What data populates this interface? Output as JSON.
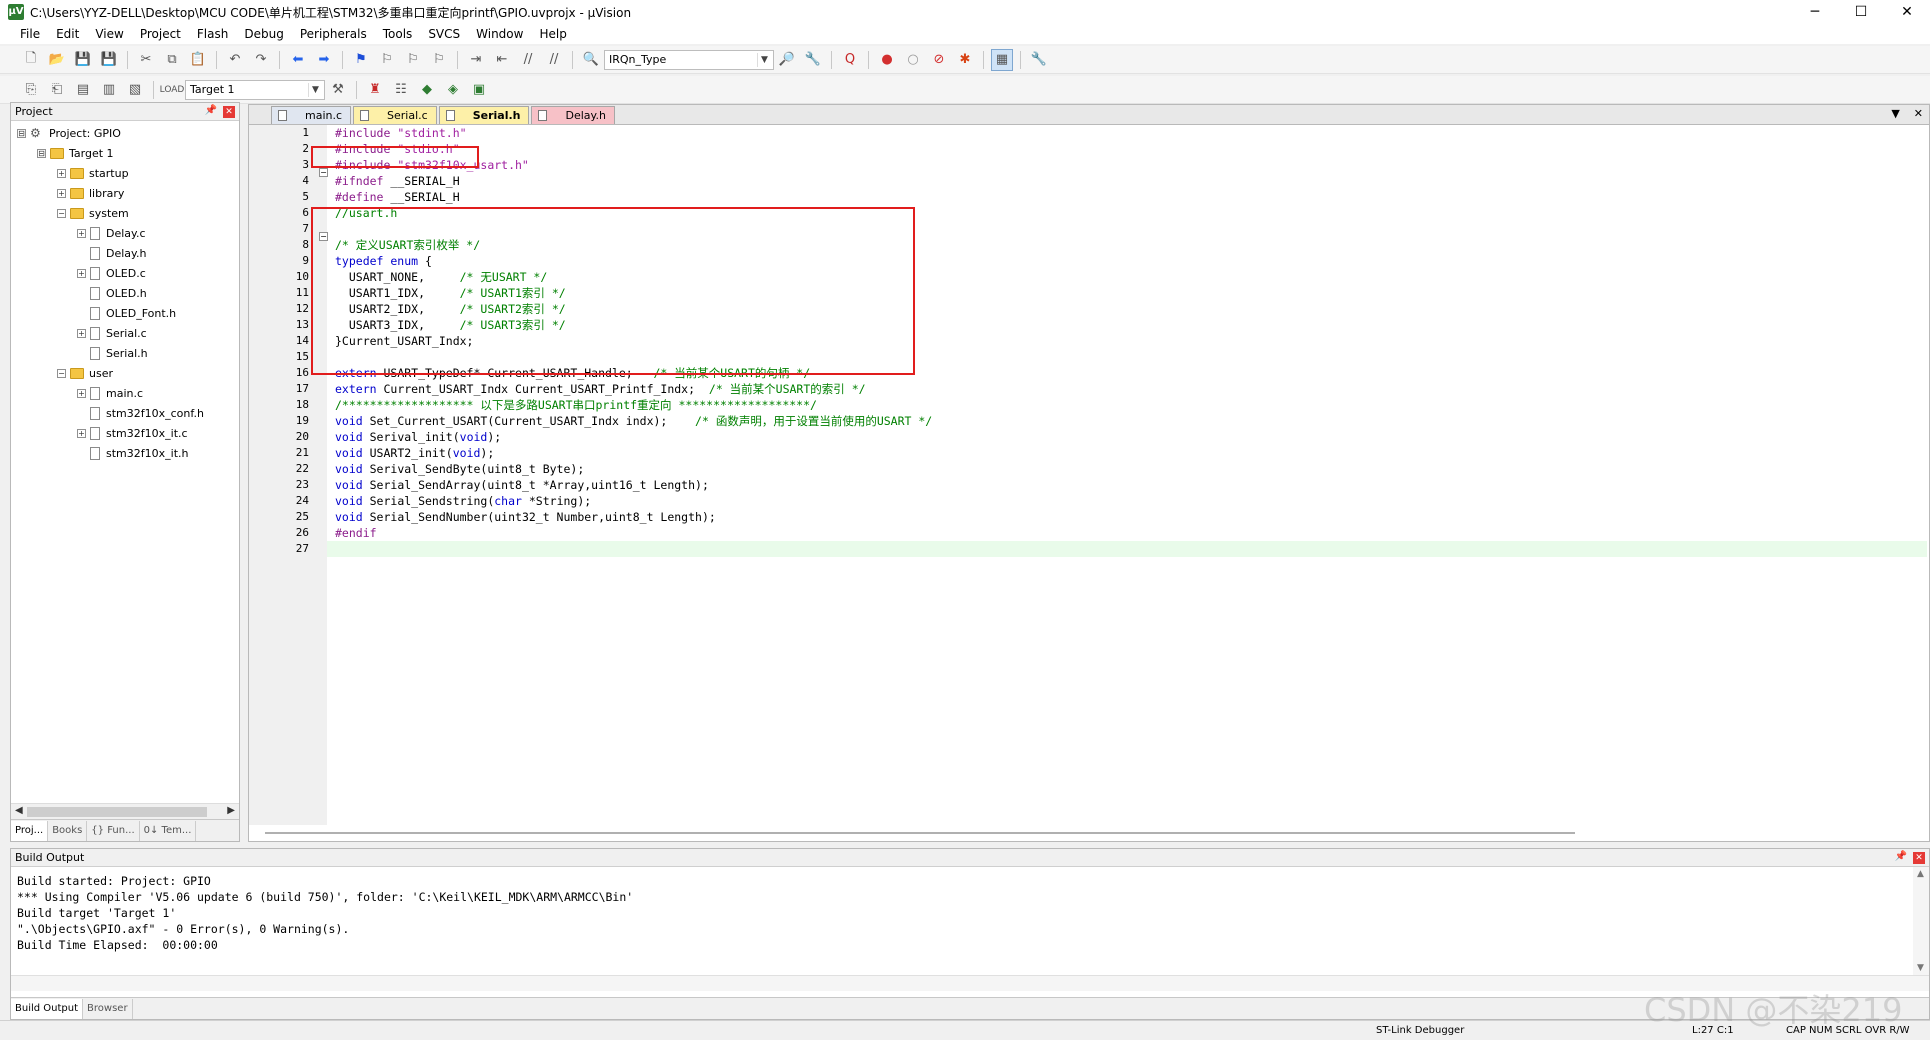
{
  "window": {
    "title": "C:\\Users\\YYZ-DELL\\Desktop\\MCU CODE\\单片机工程\\STM32\\多重串口重定向printf\\GPIO.uvprojx - µVision",
    "minimize": "─",
    "maximize": "☐",
    "close": "✕"
  },
  "menu": [
    "File",
    "Edit",
    "View",
    "Project",
    "Flash",
    "Debug",
    "Peripherals",
    "Tools",
    "SVCS",
    "Window",
    "Help"
  ],
  "toolbar": {
    "find_combo": "IRQn_Type",
    "target_combo": "Target 1"
  },
  "project_panel": {
    "title": "Project",
    "pin": "📌",
    "close": "✕",
    "tree": [
      {
        "label": "Project: GPIO",
        "type": "project",
        "expander": "⊟"
      },
      {
        "label": "Target 1",
        "type": "target",
        "expander": "⊟"
      },
      {
        "label": "startup",
        "type": "folder",
        "expander": "+"
      },
      {
        "label": "library",
        "type": "folder",
        "expander": "+"
      },
      {
        "label": "system",
        "type": "folder",
        "expander": "−"
      },
      {
        "label": "Delay.c",
        "type": "file",
        "expander": "+"
      },
      {
        "label": "Delay.h",
        "type": "file",
        "expander": ""
      },
      {
        "label": "OLED.c",
        "type": "file",
        "expander": "+"
      },
      {
        "label": "OLED.h",
        "type": "file",
        "expander": ""
      },
      {
        "label": "OLED_Font.h",
        "type": "file",
        "expander": ""
      },
      {
        "label": "Serial.c",
        "type": "file",
        "expander": "+"
      },
      {
        "label": "Serial.h",
        "type": "file",
        "expander": ""
      },
      {
        "label": "user",
        "type": "folder",
        "expander": "−"
      },
      {
        "label": "main.c",
        "type": "file",
        "expander": "+"
      },
      {
        "label": "stm32f10x_conf.h",
        "type": "file",
        "expander": ""
      },
      {
        "label": "stm32f10x_it.c",
        "type": "file",
        "expander": "+"
      },
      {
        "label": "stm32f10x_it.h",
        "type": "file",
        "expander": ""
      }
    ],
    "tabs": [
      "Proj...",
      "Books",
      "{} Fun...",
      "0↓ Tem..."
    ]
  },
  "editor": {
    "tabs": [
      "main.c",
      "Serial.c",
      "Serial.h",
      "Delay.h"
    ],
    "active_tab": "Serial.h",
    "dropdown": "▼",
    "close": "✕",
    "lines": [
      [
        {
          "t": "pp",
          "s": "#include "
        },
        {
          "t": "str",
          "s": "\"stdint.h\""
        }
      ],
      [
        {
          "t": "pp",
          "s": "#include "
        },
        {
          "t": "str",
          "s": "\"stdio.h\""
        }
      ],
      [
        {
          "t": "pp",
          "s": "#include "
        },
        {
          "t": "str",
          "s": "\"stm32f10x_usart.h\""
        }
      ],
      [
        {
          "t": "pp",
          "s": "#ifndef "
        },
        {
          "t": "plain",
          "s": "__SERIAL_H"
        }
      ],
      [
        {
          "t": "pp",
          "s": "#define "
        },
        {
          "t": "plain",
          "s": "__SERIAL_H"
        }
      ],
      [
        {
          "t": "cmt",
          "s": "//usart.h"
        }
      ],
      [
        {
          "t": "plain",
          "s": ""
        }
      ],
      [
        {
          "t": "cmt",
          "s": "/* 定义USART索引枚举 */"
        }
      ],
      [
        {
          "t": "kw",
          "s": "typedef enum "
        },
        {
          "t": "plain",
          "s": "{"
        }
      ],
      [
        {
          "t": "plain",
          "s": "  USART_NONE,     "
        },
        {
          "t": "cmt",
          "s": "/* 无USART */"
        }
      ],
      [
        {
          "t": "plain",
          "s": "  USART1_IDX,     "
        },
        {
          "t": "cmt",
          "s": "/* USART1索引 */"
        }
      ],
      [
        {
          "t": "plain",
          "s": "  USART2_IDX,     "
        },
        {
          "t": "cmt",
          "s": "/* USART2索引 */"
        }
      ],
      [
        {
          "t": "plain",
          "s": "  USART3_IDX,     "
        },
        {
          "t": "cmt",
          "s": "/* USART3索引 */"
        }
      ],
      [
        {
          "t": "plain",
          "s": "}Current_USART_Indx;"
        }
      ],
      [
        {
          "t": "plain",
          "s": ""
        }
      ],
      [
        {
          "t": "kw",
          "s": "extern "
        },
        {
          "t": "plain",
          "s": "USART_TypeDef* Current_USART_Handle;   "
        },
        {
          "t": "cmt",
          "s": "/* 当前某个USART的句柄 */"
        }
      ],
      [
        {
          "t": "kw",
          "s": "extern "
        },
        {
          "t": "plain",
          "s": "Current_USART_Indx Current_USART_Printf_Indx;  "
        },
        {
          "t": "cmt",
          "s": "/* 当前某个USART的索引 */"
        }
      ],
      [
        {
          "t": "cmt",
          "s": "/******************* 以下是多路USART串口printf重定向 *******************/"
        }
      ],
      [
        {
          "t": "kw",
          "s": "void "
        },
        {
          "t": "plain",
          "s": "Set_Current_USART(Current_USART_Indx indx);    "
        },
        {
          "t": "cmt",
          "s": "/* 函数声明，用于设置当前使用的USART */"
        }
      ],
      [
        {
          "t": "kw",
          "s": "void "
        },
        {
          "t": "plain",
          "s": "Serival_init("
        },
        {
          "t": "kw",
          "s": "void"
        },
        {
          "t": "plain",
          "s": ");"
        }
      ],
      [
        {
          "t": "kw",
          "s": "void "
        },
        {
          "t": "plain",
          "s": "USART2_init("
        },
        {
          "t": "kw",
          "s": "void"
        },
        {
          "t": "plain",
          "s": ");"
        }
      ],
      [
        {
          "t": "kw",
          "s": "void "
        },
        {
          "t": "plain",
          "s": "Serival_SendByte(uint8_t Byte);"
        }
      ],
      [
        {
          "t": "kw",
          "s": "void "
        },
        {
          "t": "plain",
          "s": "Serial_SendArray(uint8_t *Array,uint16_t Length);"
        }
      ],
      [
        {
          "t": "kw",
          "s": "void "
        },
        {
          "t": "plain",
          "s": "Serial_Sendstring("
        },
        {
          "t": "kw",
          "s": "char "
        },
        {
          "t": "plain",
          "s": "*String);"
        }
      ],
      [
        {
          "t": "kw",
          "s": "void "
        },
        {
          "t": "plain",
          "s": "Serial_SendNumber(uint32_t Number,uint8_t Length);"
        }
      ],
      [
        {
          "t": "pp",
          "s": "#endif"
        }
      ],
      [
        {
          "t": "plain",
          "s": ""
        }
      ]
    ]
  },
  "build_output": {
    "title": "Build Output",
    "lines": [
      "Build started: Project: GPIO",
      "*** Using Compiler 'V5.06 update 6 (build 750)', folder: 'C:\\Keil\\KEIL_MDK\\ARM\\ARMCC\\Bin'",
      "Build target 'Target 1'",
      "\".\\Objects\\GPIO.axf\" - 0 Error(s), 0 Warning(s).",
      "Build Time Elapsed:  00:00:00"
    ],
    "tabs": [
      "Build Output",
      "Browser"
    ]
  },
  "statusbar": {
    "debugger": "ST-Link Debugger",
    "position": "L:27 C:1",
    "indicators": "CAP  NUM  SCRL  OVR  R/W"
  },
  "watermark": "CSDN @不染219"
}
